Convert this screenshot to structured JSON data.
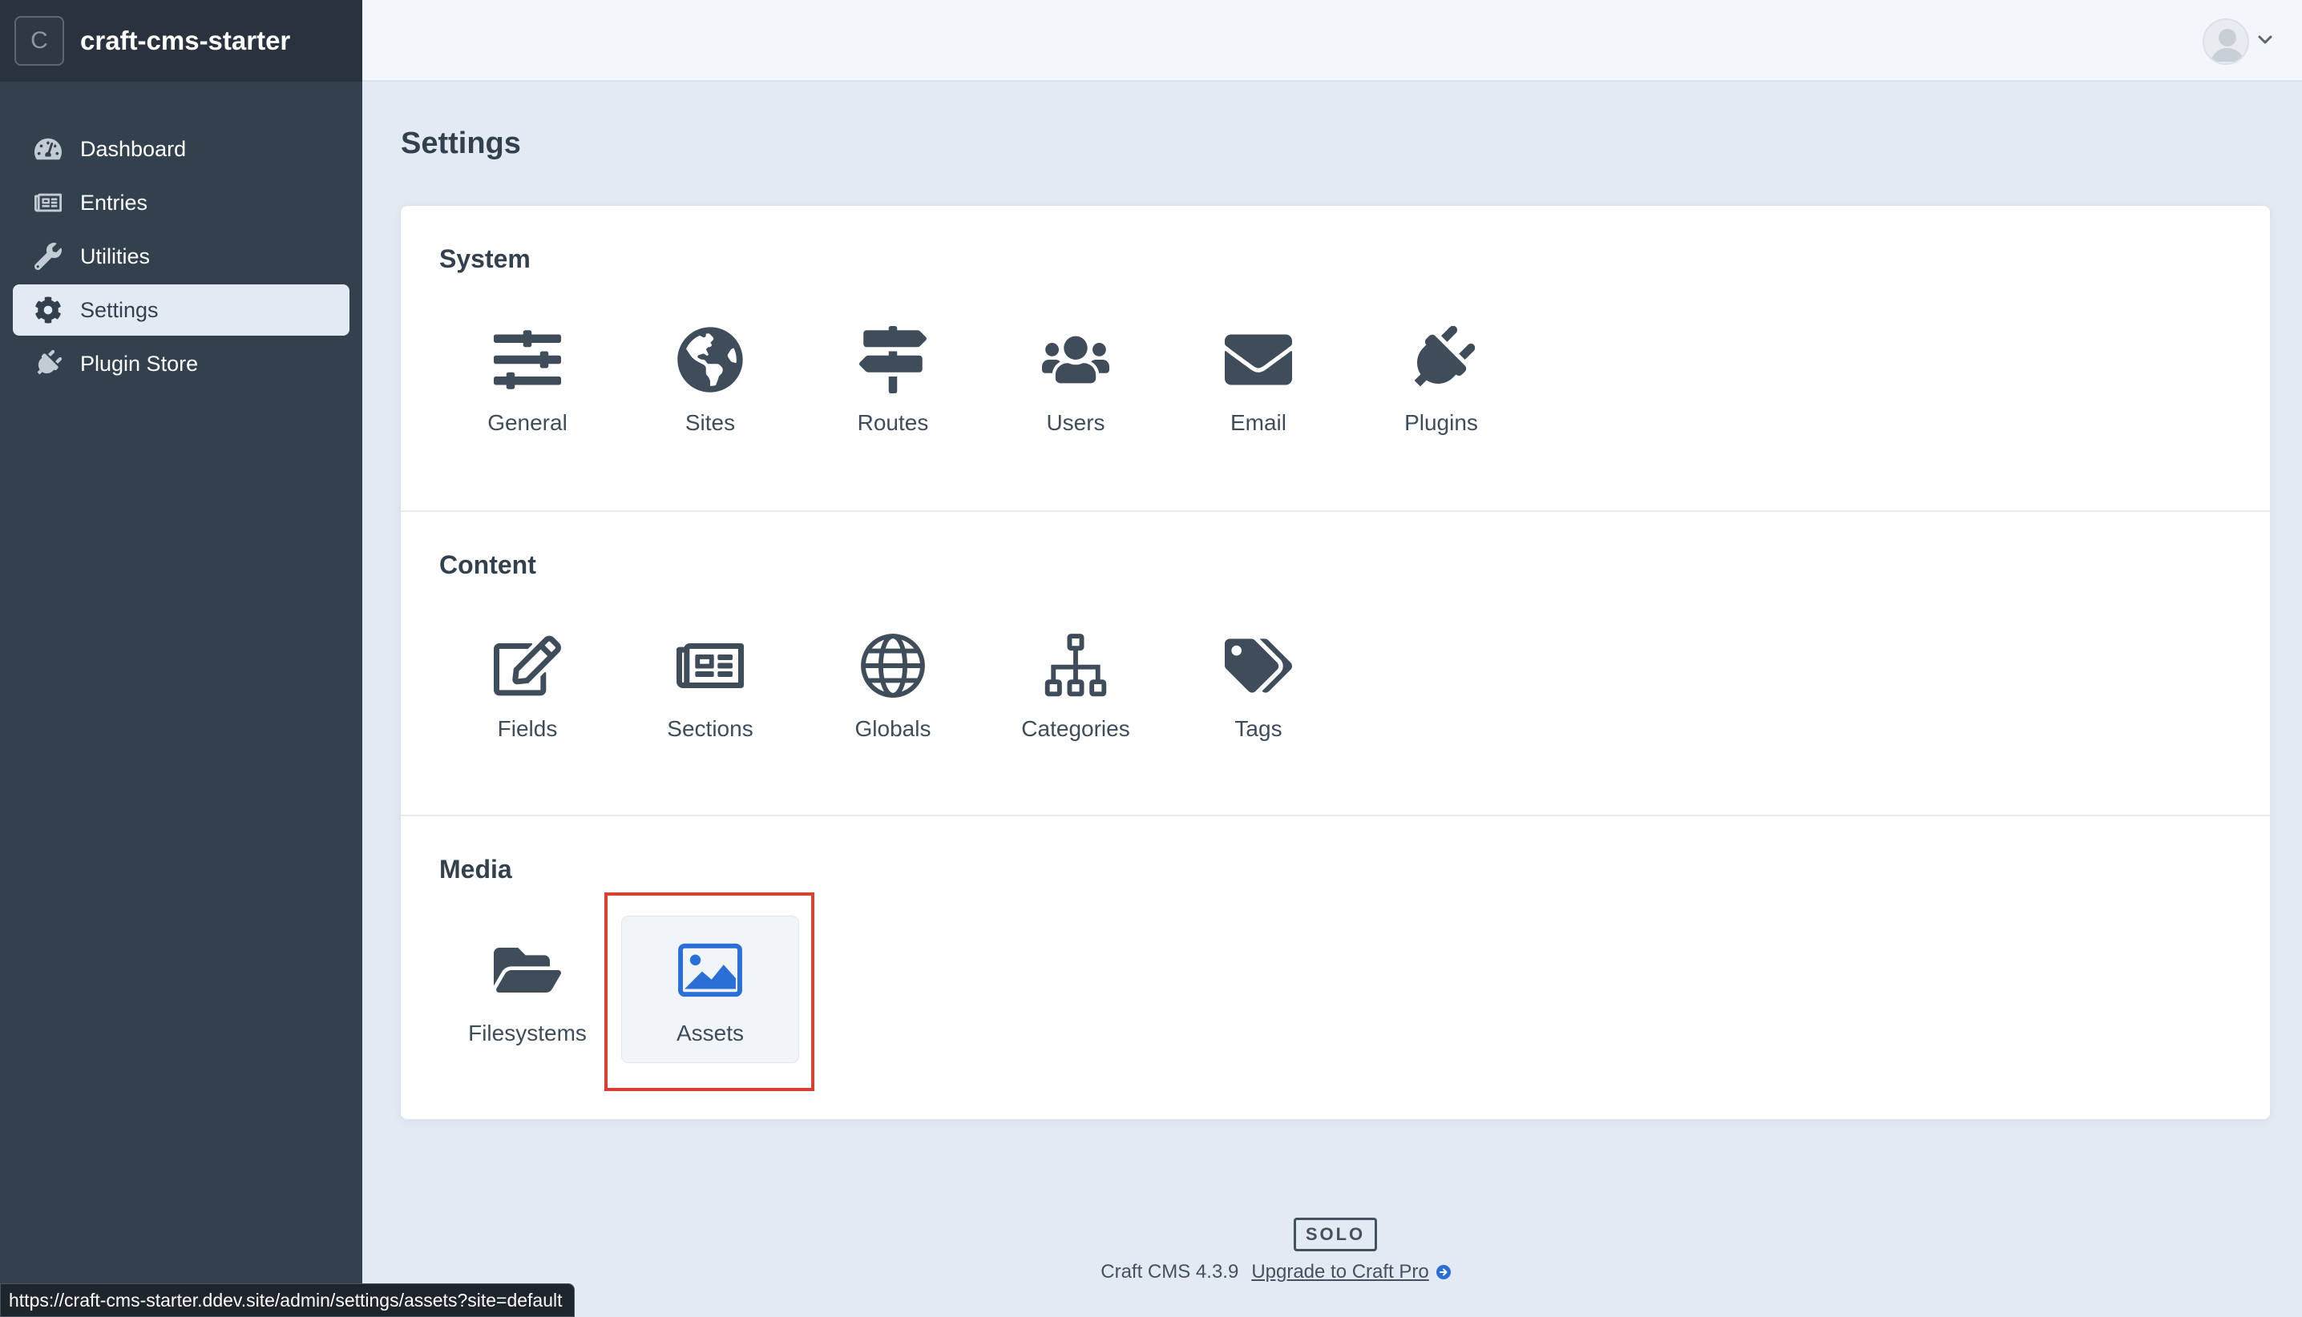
{
  "sidebar": {
    "site_badge": "C",
    "site_name": "craft-cms-starter",
    "items": [
      {
        "label": "Dashboard",
        "icon": "gauge-icon",
        "active": false
      },
      {
        "label": "Entries",
        "icon": "newspaper-icon",
        "active": false
      },
      {
        "label": "Utilities",
        "icon": "wrench-icon",
        "active": false
      },
      {
        "label": "Settings",
        "icon": "gear-icon",
        "active": true
      },
      {
        "label": "Plugin Store",
        "icon": "plug-icon",
        "active": false
      }
    ]
  },
  "header": {
    "user_icon": "user-avatar-icon",
    "menu_icon": "chevron-down-icon"
  },
  "main": {
    "title": "Settings",
    "sections": [
      {
        "title": "System",
        "items": [
          {
            "label": "General",
            "icon": "sliders-icon"
          },
          {
            "label": "Sites",
            "icon": "globe-americas-icon"
          },
          {
            "label": "Routes",
            "icon": "signpost-icon"
          },
          {
            "label": "Users",
            "icon": "users-icon"
          },
          {
            "label": "Email",
            "icon": "envelope-icon"
          },
          {
            "label": "Plugins",
            "icon": "plug-icon"
          }
        ]
      },
      {
        "title": "Content",
        "items": [
          {
            "label": "Fields",
            "icon": "pen-square-icon"
          },
          {
            "label": "Sections",
            "icon": "newspaper-icon"
          },
          {
            "label": "Globals",
            "icon": "globe-icon"
          },
          {
            "label": "Categories",
            "icon": "sitemap-icon"
          },
          {
            "label": "Tags",
            "icon": "tags-icon"
          }
        ]
      },
      {
        "title": "Media",
        "items": [
          {
            "label": "Filesystems",
            "icon": "folder-open-icon"
          },
          {
            "label": "Assets",
            "icon": "image-icon",
            "selected": true
          }
        ]
      }
    ]
  },
  "footer": {
    "edition": "SOLO",
    "version": "Craft CMS 4.3.9",
    "upgrade_label": "Upgrade to Craft Pro"
  },
  "status_bar": {
    "url": "https://craft-cms-starter.ddev.site/admin/settings/assets?site=default"
  },
  "colors": {
    "sidebar_bg": "#33404d",
    "page_bg": "#e4eaf3",
    "accent_blue": "#2a6fd6",
    "highlight_red": "#d8402f"
  }
}
